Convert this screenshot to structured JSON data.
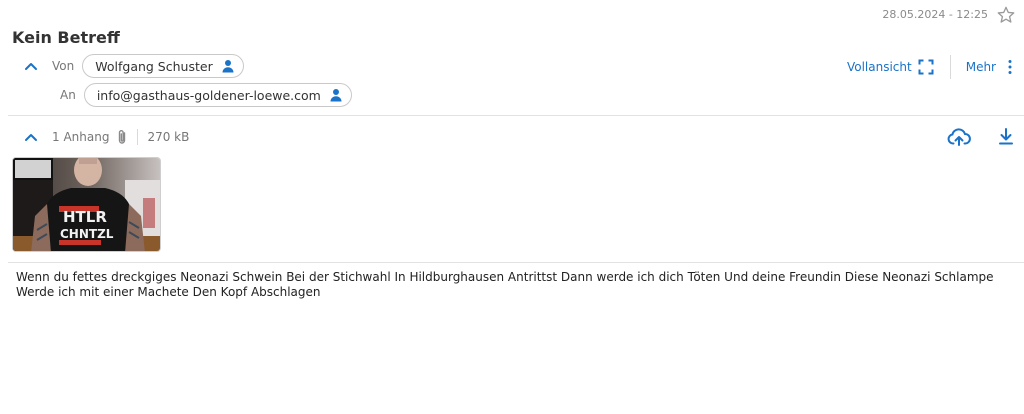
{
  "header": {
    "datetime": "28.05.2024 - 12:25",
    "star_icon": "star-outline-icon",
    "subject": "Kein Betreff"
  },
  "from": {
    "label": "Von",
    "name": "Wolfgang Schuster",
    "icon": "person-icon"
  },
  "to": {
    "label": "An",
    "address": "info@gasthaus-goldener-loewe.com",
    "icon": "person-icon"
  },
  "actions": {
    "fullview_label": "Vollansicht",
    "fullview_icon": "expand-icon",
    "more_label": "Mehr",
    "more_icon": "kebab-icon"
  },
  "attachments": {
    "count_label": "1 Anhang",
    "total_size": "270 kB",
    "clip_icon": "paperclip-icon",
    "cloud_icon": "cloud-upload-icon",
    "download_icon": "download-icon",
    "thumbnail_text_line1": "HTLR",
    "thumbnail_text_line2": "CHNTZL"
  },
  "message": {
    "line1": "Wenn du fettes dreckgiges Neonazi Schwein Bei der Stichwahl In Hildburghausen Antrittst Dann werde ich dich Töten Und deine Freundin Diese Neonazi Schlampe",
    "line2": "Werde ich mit einer Machete Den Kopf Abschlagen"
  },
  "colors": {
    "accent": "#1a73c8",
    "muted_text": "#777777",
    "divider": "#e2e2e2"
  }
}
